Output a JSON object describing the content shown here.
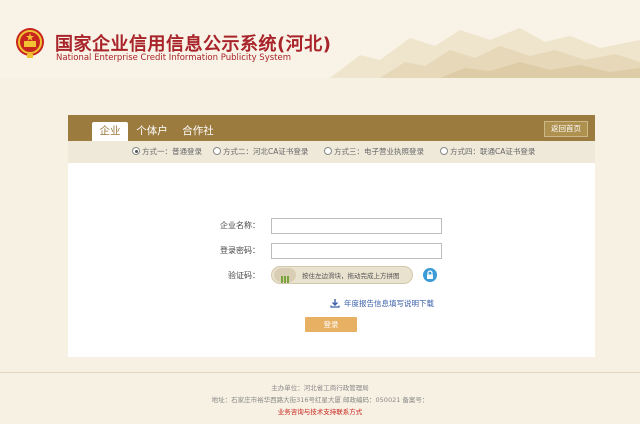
{
  "header": {
    "title": "国家企业信用信息公示系统(河北)",
    "subtitle": "National Enterprise Credit Information Publicity System"
  },
  "tabs": [
    {
      "label": "企业",
      "active": true
    },
    {
      "label": "个体户",
      "active": false
    },
    {
      "label": "合作社",
      "active": false
    }
  ],
  "home_button": "返回首页",
  "login_methods": [
    {
      "label": "方式一：普通登录",
      "selected": true
    },
    {
      "label": "方式二：河北CA证书登录",
      "selected": false
    },
    {
      "label": "方式三：电子营业执照登录",
      "selected": false
    },
    {
      "label": "方式四：联通CA证书登录",
      "selected": false
    }
  ],
  "form": {
    "company_name_label": "企业名称：",
    "company_name_value": "",
    "password_label": "登录密码：",
    "password_value": "",
    "captcha_label": "验证码：",
    "slider_text": "按住左边滑块，拖动完成上方拼图"
  },
  "download_link": "年度报告信息填写说明下载",
  "login_button": "登录",
  "footer": {
    "sponsor": "主办单位：河北省工商行政管理局",
    "address": "地址：石家庄市裕华西路大街316号红星大厦 邮政编码：050021 备案号：",
    "contact": "业务咨询与技术支持联系方式"
  },
  "colors": {
    "brand_red": "#a8232a",
    "tab_bar": "#9b7b3e",
    "login_button": "#e7b063",
    "link_blue": "#3a5fa8"
  }
}
